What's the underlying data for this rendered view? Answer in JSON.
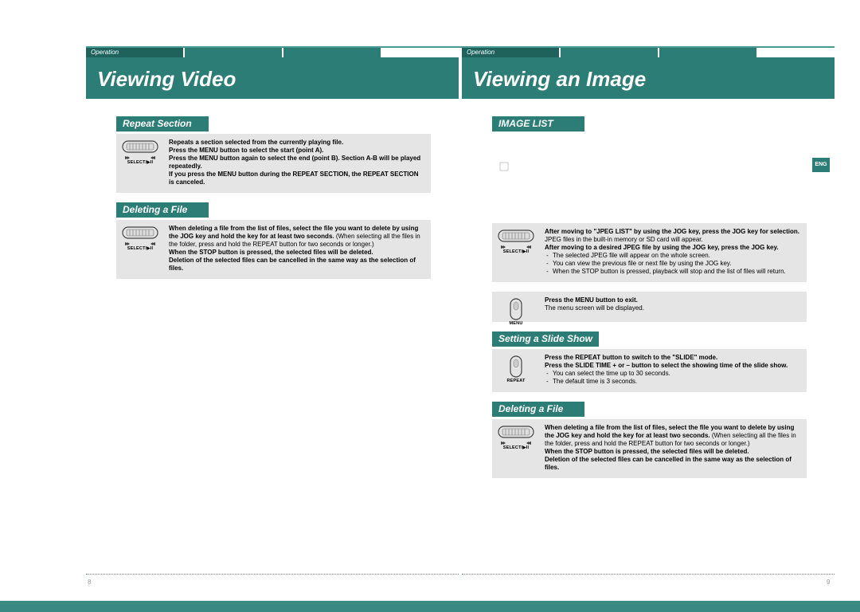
{
  "header": {
    "tab_label": "Operation",
    "eng": "ENG"
  },
  "leftPage": {
    "title": "Viewing Video",
    "sections": {
      "repeat": {
        "heading": "Repeat Section",
        "icon_label": "SELECT/▶II",
        "b1": "Repeats a section selected from the currently playing file.",
        "b2": "Press the MENU button to select the start (point A).",
        "b3": "Press the MENU button again to select the end (point B). Section A-B will be played repeatedly.",
        "b4": "If you press the MENU button during the REPEAT SECTION, the REPEAT SECTION is canceled."
      },
      "delete": {
        "heading": "Deleting a File",
        "icon_label": "SELECT/▶II",
        "b1a": "When deleting a file from the list of files, select the file you want to delete by using the JOG key and hold the key for at least two seconds.",
        "b1b": " (When selecting all the files in the folder, press and hold the REPEAT button for two seconds or longer.)",
        "b2": "When the STOP button is pressed, the selected files will be deleted.",
        "b3": "Deletion of the selected files can be cancelled in the same way as the selection of files."
      }
    },
    "pagenum": "8"
  },
  "rightPage": {
    "title": "Viewing an Image",
    "sections": {
      "imagelist": {
        "heading": "IMAGE LIST",
        "block1": {
          "icon_label": "SELECT/▶II",
          "b1": "After moving to \"JPEG LIST\" by using the JOG key, press the JOG key for selection.",
          "b1n": "JPEG files in the built-in memory or SD card will appear.",
          "b2": "After moving to a desired JPEG file by using the JOG key, press the JOG key.",
          "li1": "The selected JPEG file will appear on the whole screen.",
          "li2": "You can view the previous file or next file by using the JOG key.",
          "li3": "When the STOP button is pressed, playback will stop and the list of files will return."
        },
        "block2": {
          "icon_label": "MENU",
          "b1": "Press the MENU button to exit.",
          "b1n": "The menu screen will be displayed."
        }
      },
      "slide": {
        "heading": "Setting a Slide Show",
        "icon_label": "REPEAT",
        "b1": "Press the REPEAT button to switch to the \"SLIDE\" mode.",
        "b2": "Press the SLIDE TIME + or – button to select the showing time of the slide show.",
        "li1": "You can select the time up to 30 seconds.",
        "li2": "The default time is 3 seconds."
      },
      "delete": {
        "heading": "Deleting a File",
        "icon_label": "SELECT/▶II",
        "b1a": "When deleting a file from the list of files, select the file you want to delete by using the JOG key and hold the key for at least two seconds.",
        "b1b": " (When selecting all the files in the folder, press and hold the REPEAT button for two seconds or longer.)",
        "b2": "When the STOP button is pressed, the selected files will be deleted.",
        "b3": "Deletion of the selected files can be cancelled in the same way as the selection of files."
      }
    },
    "pagenum": "9"
  }
}
